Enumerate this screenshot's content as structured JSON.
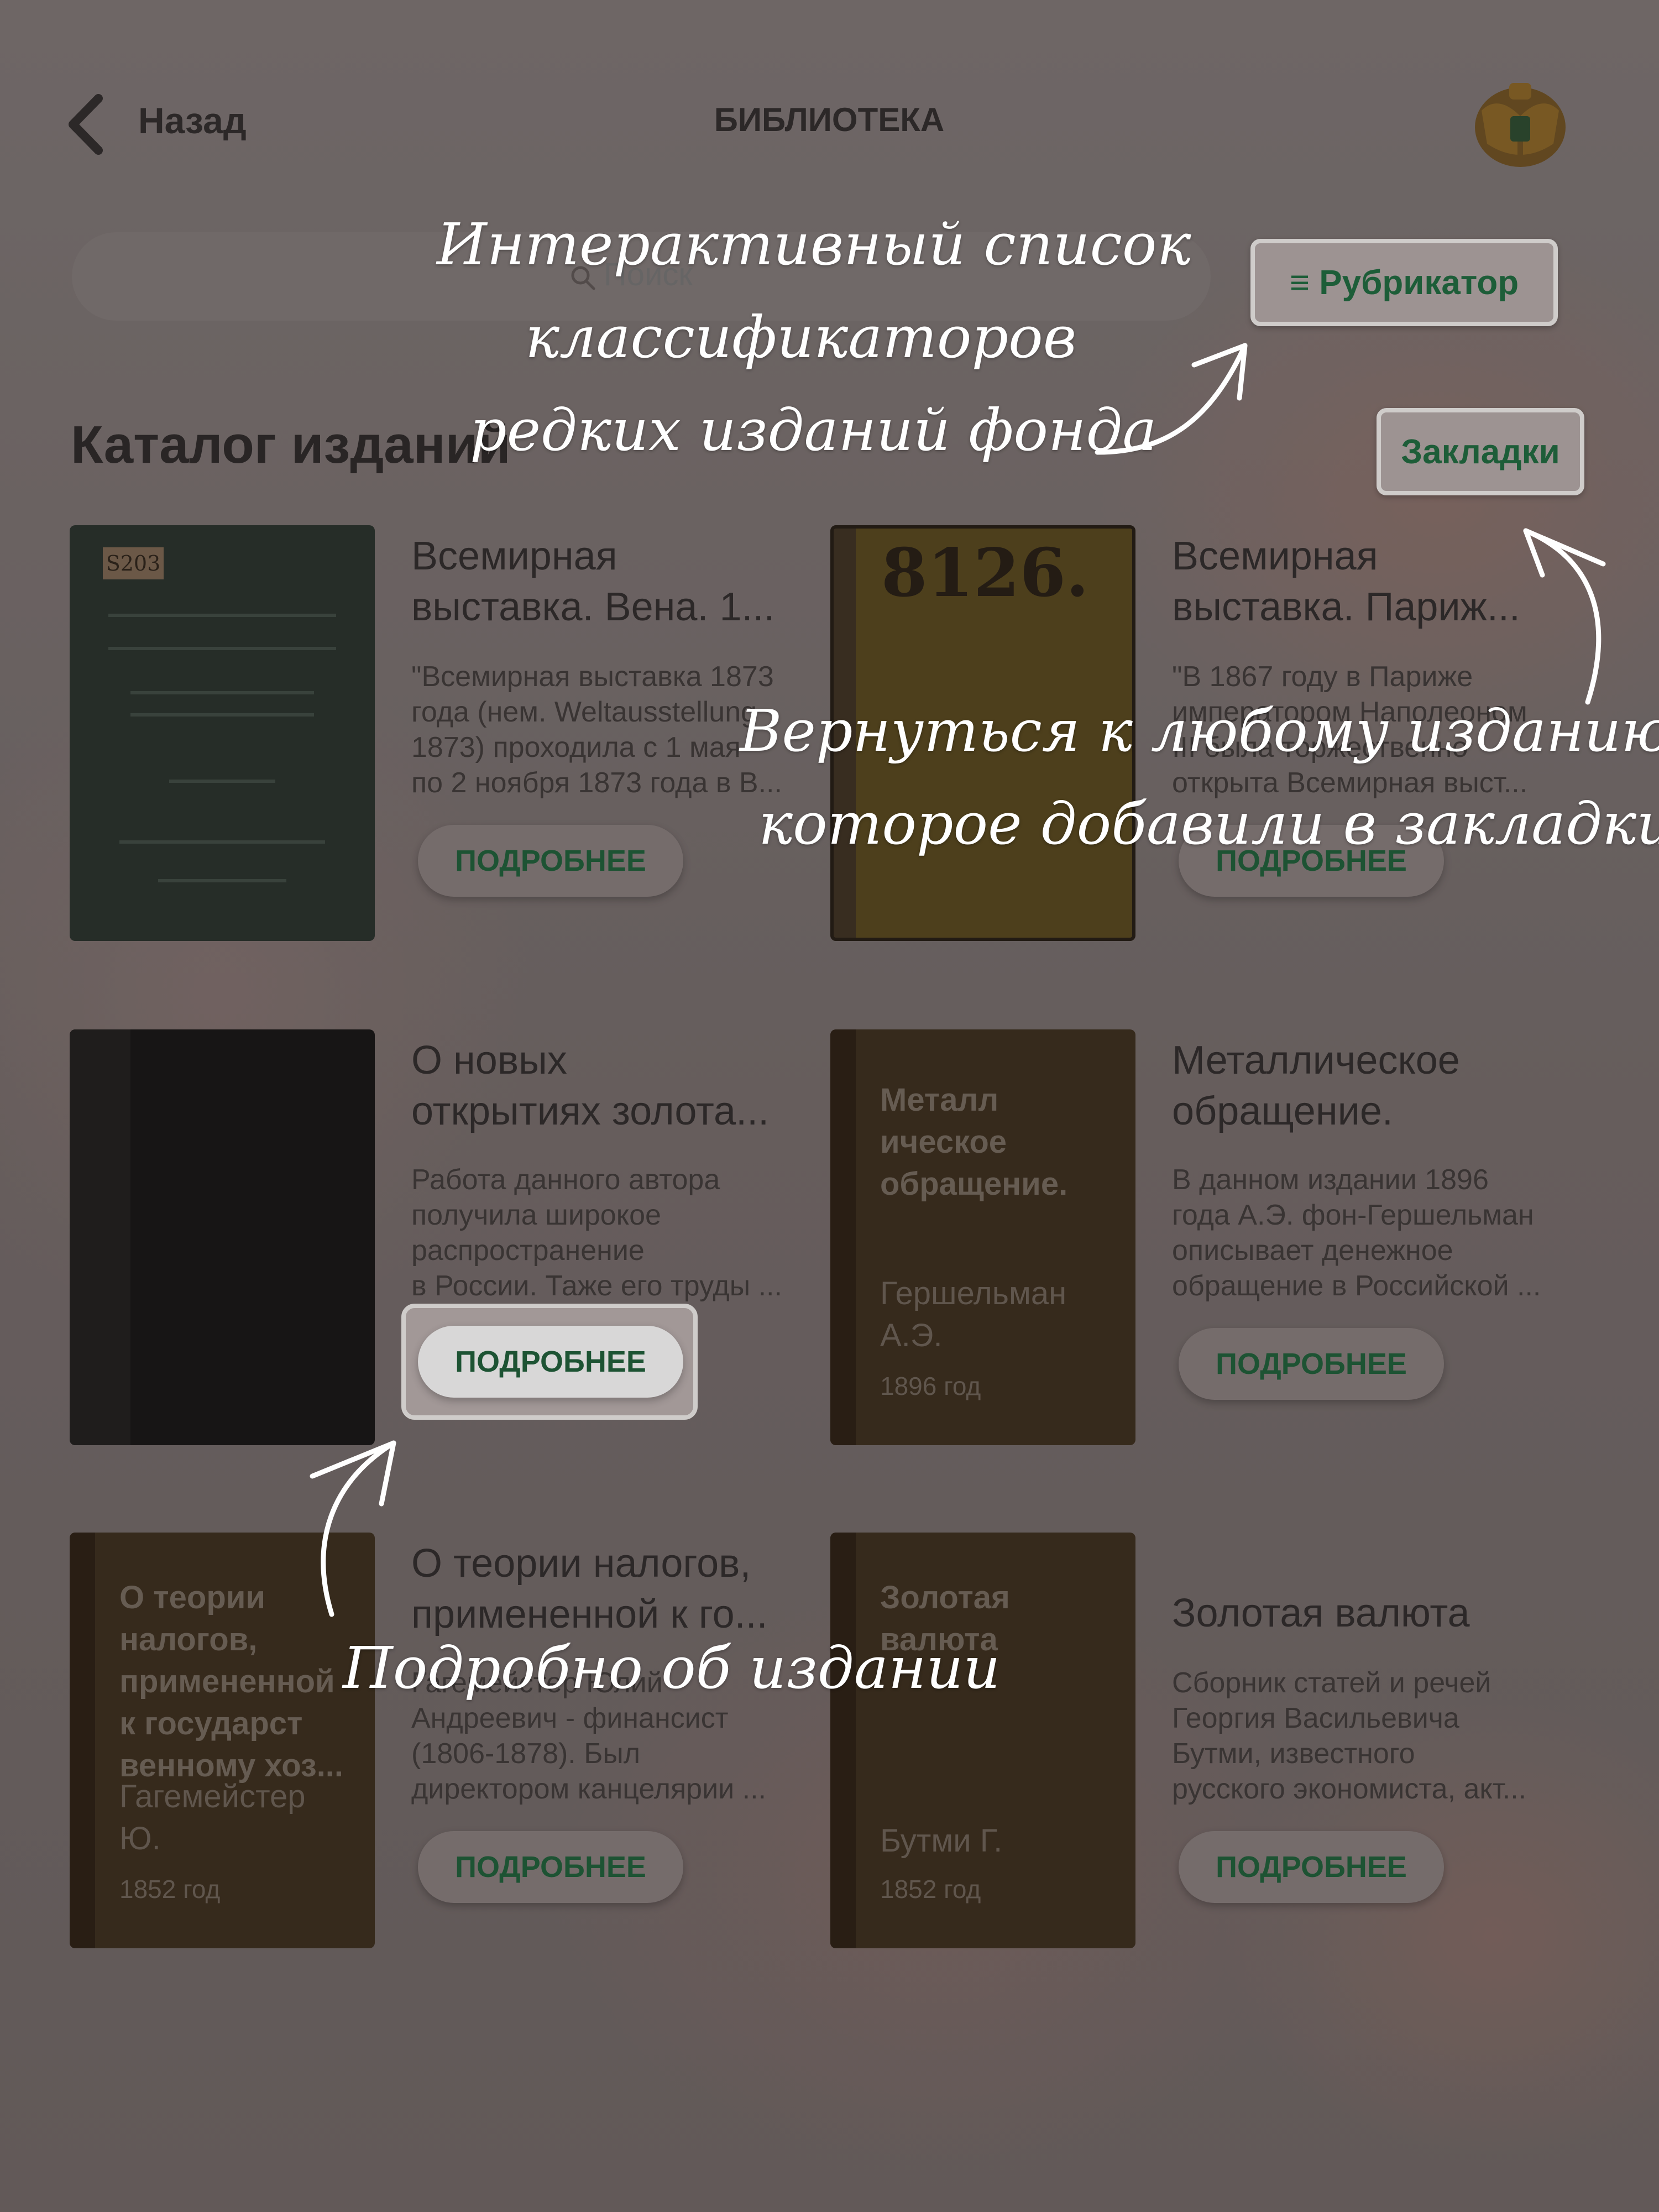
{
  "header": {
    "back_label": "Назад",
    "title": "БИБЛИОТЕКА"
  },
  "search": {
    "placeholder": "Поиск"
  },
  "toolbar": {
    "rubricator_label": "≡ Рубрикатор",
    "bookmarks_label": "Закладки"
  },
  "catalog": {
    "title": "Каталог изданий",
    "more_label": "ПОДРОБНЕЕ",
    "cards": [
      {
        "title_lines": [
          "Всемирная",
          "выставка. Вена. 1..."
        ],
        "desc_lines": [
          "\"Всемирная выставка 1873",
          "года (нем. Weltausstellung",
          "1873) проходила с 1 мая",
          "по 2 ноября 1873 года в В..."
        ],
        "cover_label": "S203"
      },
      {
        "title_lines": [
          "Всемирная",
          "выставка. Париж..."
        ],
        "desc_lines": [
          "\"В 1867 году в Париже",
          "императором Наполеоном",
          "III была торжественно",
          "открыта Всемирная выст..."
        ],
        "cover_label": "8126."
      },
      {
        "title_lines": [
          " О новых",
          "открытиях золота..."
        ],
        "desc_lines": [
          "Работа данного автора",
          "получила широкое",
          "распространение",
          "в России. Таже его труды ..."
        ]
      },
      {
        "title_lines": [
          "Металлическое",
          "обращение."
        ],
        "desc_lines": [
          "В данном издании 1896",
          "года А.Э. фон-Гершельман",
          "описывает денежное",
          "обращение в Российской ..."
        ],
        "cover_title_lines": [
          "Металл",
          "ическое",
          "обращение."
        ],
        "cover_author_lines": [
          "Гершельман",
          "А.Э."
        ],
        "cover_year": "1896 год"
      },
      {
        "title_lines": [
          " О теории налогов,",
          "примененной к го..."
        ],
        "desc_lines": [
          "Гагемейстер Юлий",
          "Андреевич - финансист",
          "(1806-1878). Был",
          "директором канцелярии ..."
        ],
        "cover_title_lines": [
          " О теории",
          "налогов,",
          "примененной",
          "к государст",
          "венному хоз..."
        ],
        "cover_author_lines": [
          "Гагемейстер",
          "Ю."
        ],
        "cover_year": "1852 год"
      },
      {
        "title_lines": [
          "Золотая валюта"
        ],
        "desc_lines": [
          "Сборник статей и речей",
          "Георгия Васильевича",
          "Бутми, известного",
          "русского экономиста, акт..."
        ],
        "cover_title_lines": [
          "Золотая",
          "валюта"
        ],
        "cover_author_lines": [
          "Бутми Г."
        ],
        "cover_year": "1852 год"
      }
    ]
  },
  "annotations": {
    "rubricator_note": [
      "Интерактивный список",
      "классификаторов",
      "редких изданий фонда"
    ],
    "bookmarks_note": [
      "Вернуться к любому изданию,",
      "которое добавили в закладки"
    ],
    "details_note": "Подробно об издании"
  },
  "colors": {
    "accent_green": "#1b6b3e",
    "annotation_text": "#ffffff"
  }
}
